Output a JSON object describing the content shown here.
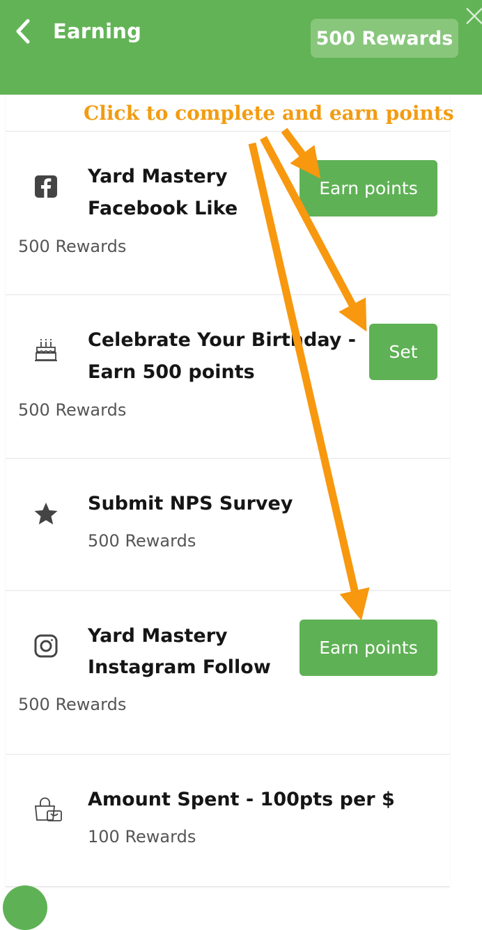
{
  "header": {
    "title": "Earning",
    "points_badge": "500 Rewards",
    "back_icon": "chevron-left-icon",
    "close_icon": "close-icon"
  },
  "annotation": {
    "text": "Click to complete and earn points",
    "color": "#f29c12"
  },
  "colors": {
    "brand_green": "#62b356",
    "button_green": "#5fb155"
  },
  "cards": [
    {
      "icon": "facebook-icon",
      "title_lines": [
        "Yard Mastery",
        "Facebook Like"
      ],
      "reward": "500 Rewards",
      "button": "Earn points"
    },
    {
      "icon": "birthday-cake-icon",
      "title_lines": [
        "Celebrate Your Birthday -",
        "Earn 500 points"
      ],
      "reward": "500 Rewards",
      "button": "Set"
    },
    {
      "icon": "star-icon",
      "title_lines": [
        "Submit NPS Survey"
      ],
      "reward": "500 Rewards",
      "button": null
    },
    {
      "icon": "instagram-icon",
      "title_lines": [
        "Yard Mastery",
        "Instagram Follow"
      ],
      "reward": "500 Rewards",
      "button": "Earn points"
    },
    {
      "icon": "shopping-bag-icon",
      "title_lines": [
        "Amount Spent - 100pts per $"
      ],
      "reward": "100 Rewards",
      "button": null
    }
  ]
}
